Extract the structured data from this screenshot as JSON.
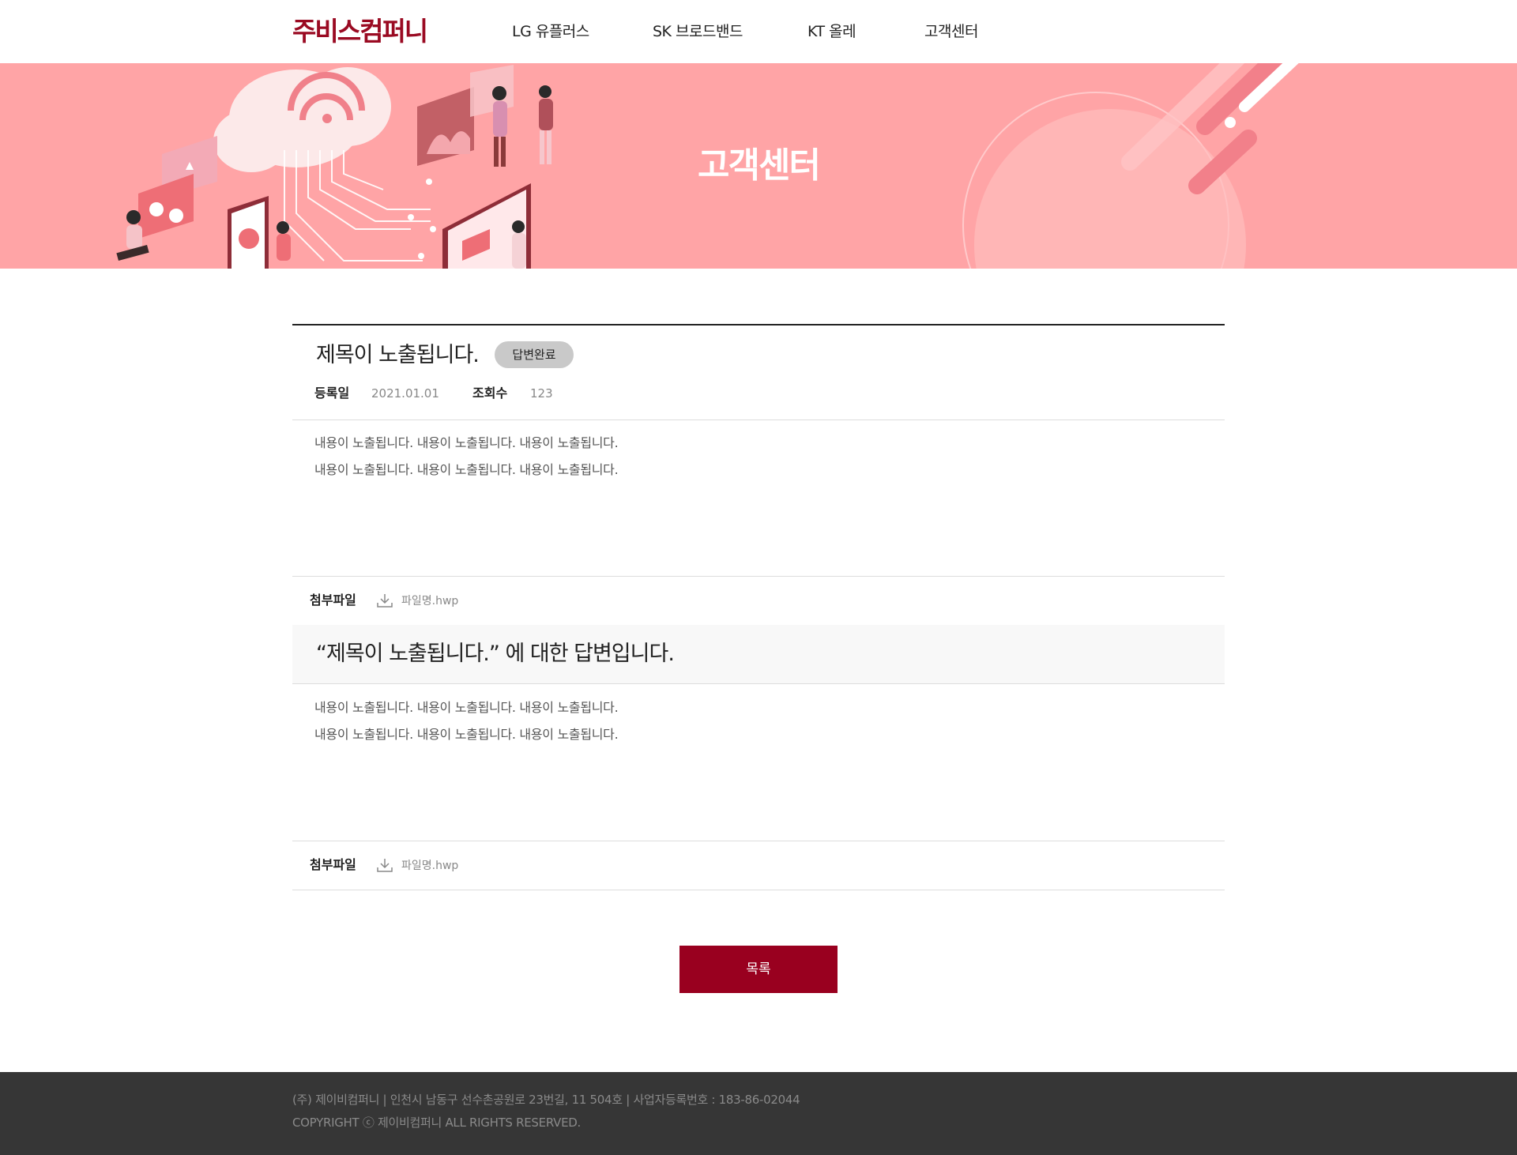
{
  "header": {
    "logo": "주비스컴퍼니",
    "nav": [
      "LG 유플러스",
      "SK 브로드밴드",
      "KT 올레",
      "고객센터"
    ]
  },
  "banner": {
    "title": "고객센터"
  },
  "post": {
    "title": "제목이 노출됩니다.",
    "status_badge": "답변완료",
    "date_label": "등록일",
    "date_value": "2021.01.01",
    "views_label": "조회수",
    "views_value": "123",
    "body": [
      "내용이 노출됩니다. 내용이 노출됩니다. 내용이 노출됩니다.",
      "내용이 노출됩니다. 내용이 노출됩니다. 내용이 노출됩니다."
    ],
    "attach_label": "첨부파일",
    "attach_file": "파일명.hwp"
  },
  "answer": {
    "title": "“제목이 노출됩니다.” 에 대한 답변입니다.",
    "body": [
      "내용이 노출됩니다. 내용이 노출됩니다. 내용이 노출됩니다.",
      "내용이 노출됩니다. 내용이 노출됩니다. 내용이 노출됩니다."
    ],
    "attach_label": "첨부파일",
    "attach_file": "파일명.hwp"
  },
  "list_button": "목록",
  "footer": {
    "line1": "(주) 제이비컴퍼니  |  인천시 남동구 선수촌공원로 23번길, 11 504호  |  사업자등록번호 : 183-86-02044",
    "line2": "COPYRIGHT ⓒ 제이비컴퍼니 ALL RIGHTS RESERVED."
  },
  "colors": {
    "brand": "#9a0a22",
    "banner_bg": "#ffa4a6",
    "button_bg": "#99001f",
    "footer_bg": "#363636"
  }
}
